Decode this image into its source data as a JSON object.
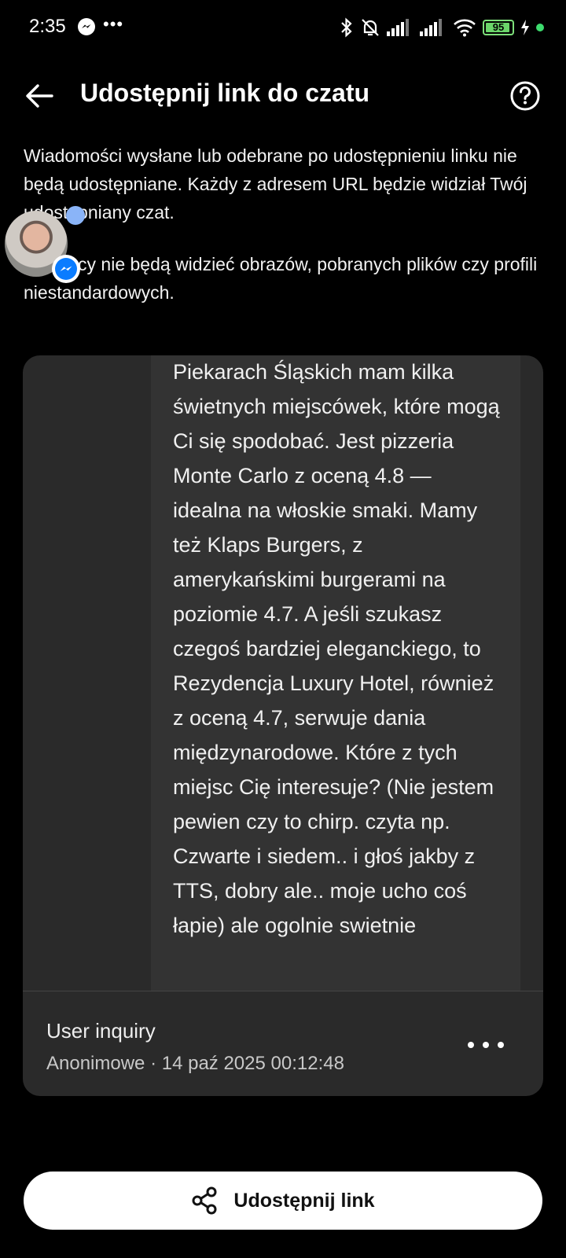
{
  "status_bar": {
    "time": "2:35",
    "dots": "•••",
    "battery": "95",
    "battery_color": "#6bd66a"
  },
  "header": {
    "title": "Udostępnij link do czatu",
    "back_icon": "arrow-left-icon",
    "help_icon": "question-circle-icon"
  },
  "description": {
    "paragraph_1": "Wiadomości wysłane lub odebrane po udostępnieniu linku nie będą udostępniane. Każdy z adresem URL będzie widział Twój udostępniany czat.",
    "paragraph_2": "Odbiorcy nie będą widzieć obrazów, pobranych plików czy profili niestandardowych."
  },
  "chat_preview": {
    "message": "Piekarach Śląskich mam kilka świetnych miejscówek, które mogą Ci się spodobać. Jest pizzeria Monte Carlo z oceną 4.8 — idealna na włoskie smaki. Mamy też Klaps Burgers, z amerykańskimi burgerami na poziomie 4.7. A jeśli szukasz czegoś bardziej eleganckiego, to Rezydencja Luxury Hotel, również z oceną 4.7, serwuje dania międzynarodowe. Które z tych miejsc Cię interesuje? (Nie jestem pewien czy to chirp. czyta np. Czwarte i siedem.. i głoś jakby z TTS, dobry ale.. moje ucho coś łapie) ale ogolnie swietnie",
    "title": "User inquiry",
    "meta": "Anonimowe · 14 paź 2025 00:12:48",
    "more_icon": "more-horizontal-icon"
  },
  "share_button": {
    "label": "Udostępnij link",
    "icon": "share-icon"
  },
  "colors": {
    "background": "#000000",
    "card": "#2a2a2a",
    "bubble": "#333333",
    "button": "#ffffff",
    "messenger": "#0a7cff"
  }
}
